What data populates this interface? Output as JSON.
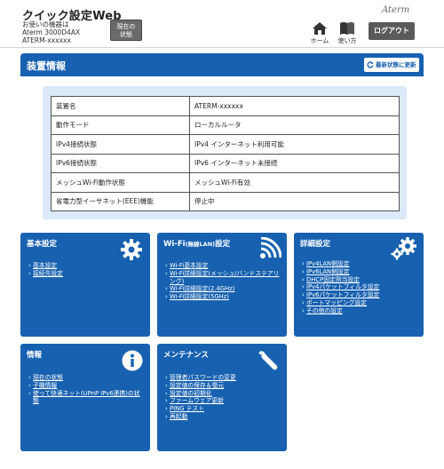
{
  "header": {
    "title": "クイック設定Web",
    "device_line1": "お使いの機器は",
    "device_line2": "Aterm 3000D4AX",
    "device_line3": "ATERM-xxxxxx",
    "status_label_1": "現在の",
    "status_label_2": "状態",
    "brand": "Aterm",
    "home_label": "ホーム",
    "guide_label": "使い方",
    "logout_label": "ログアウト"
  },
  "device_section": {
    "title": "装置情報",
    "refresh_label": "最新状態に更新",
    "rows": [
      {
        "key": "装置名",
        "value": "ATERM-xxxxxx"
      },
      {
        "key": "動作モード",
        "value": "ローカルルータ"
      },
      {
        "key": "IPv4接続状態",
        "value": "IPv4 インターネット利用可能"
      },
      {
        "key": "IPv6接続状態",
        "value": "IPv6 インターネット未接続"
      },
      {
        "key": "メッシュWi-Fi動作状態",
        "value": "メッシュWi-Fi有効"
      },
      {
        "key": "省電力型イーサネット(EEE)機能",
        "value": "停止中"
      }
    ]
  },
  "tiles": {
    "basic": {
      "title": "基本設定",
      "links": [
        "基本設定",
        "接続先設定"
      ]
    },
    "wifi": {
      "title": "Wi-Fi",
      "title_small": "(無線LAN)",
      "title_suffix": "設定",
      "links": [
        "Wi-Fi基本設定",
        "Wi-Fi詳細設定(メッシュ/バンドステアリング)",
        "Wi-Fi詳細設定(2.4GHz)",
        "Wi-Fi詳細設定(5GHz)"
      ]
    },
    "advanced": {
      "title": "詳細設定",
      "links": [
        "IPv4LAN側設定",
        "IPv6LAN側設定",
        "DHCP固定割当設定",
        "IPv4パケットフィルタ設定",
        "IPv6パケットフィルタ設定",
        "ポートマッピング設定",
        "その他の設定"
      ]
    },
    "info": {
      "title": "情報",
      "links": [
        "現在の状態",
        "子機情報",
        "使って快適ネット(UPnP IPv6連携)の状態"
      ]
    },
    "maintenance": {
      "title": "メンテナンス",
      "links": [
        "管理者パスワードの変更",
        "設定値の保存＆復元",
        "設定値の初期化",
        "ファームウェア更新",
        "PING テスト",
        "再起動"
      ]
    }
  },
  "colors": {
    "primary_blue": "#1761b0",
    "panel_blue": "#dbe9f8",
    "button_gray": "#5a5a5a"
  },
  "icons": {
    "home": "home-icon",
    "guide": "book-icon",
    "refresh": "refresh-icon",
    "basic": "gear-icon",
    "wifi": "wifi-icon",
    "advanced": "gears-icon",
    "info": "info-icon",
    "maintenance": "wrench-icon"
  }
}
